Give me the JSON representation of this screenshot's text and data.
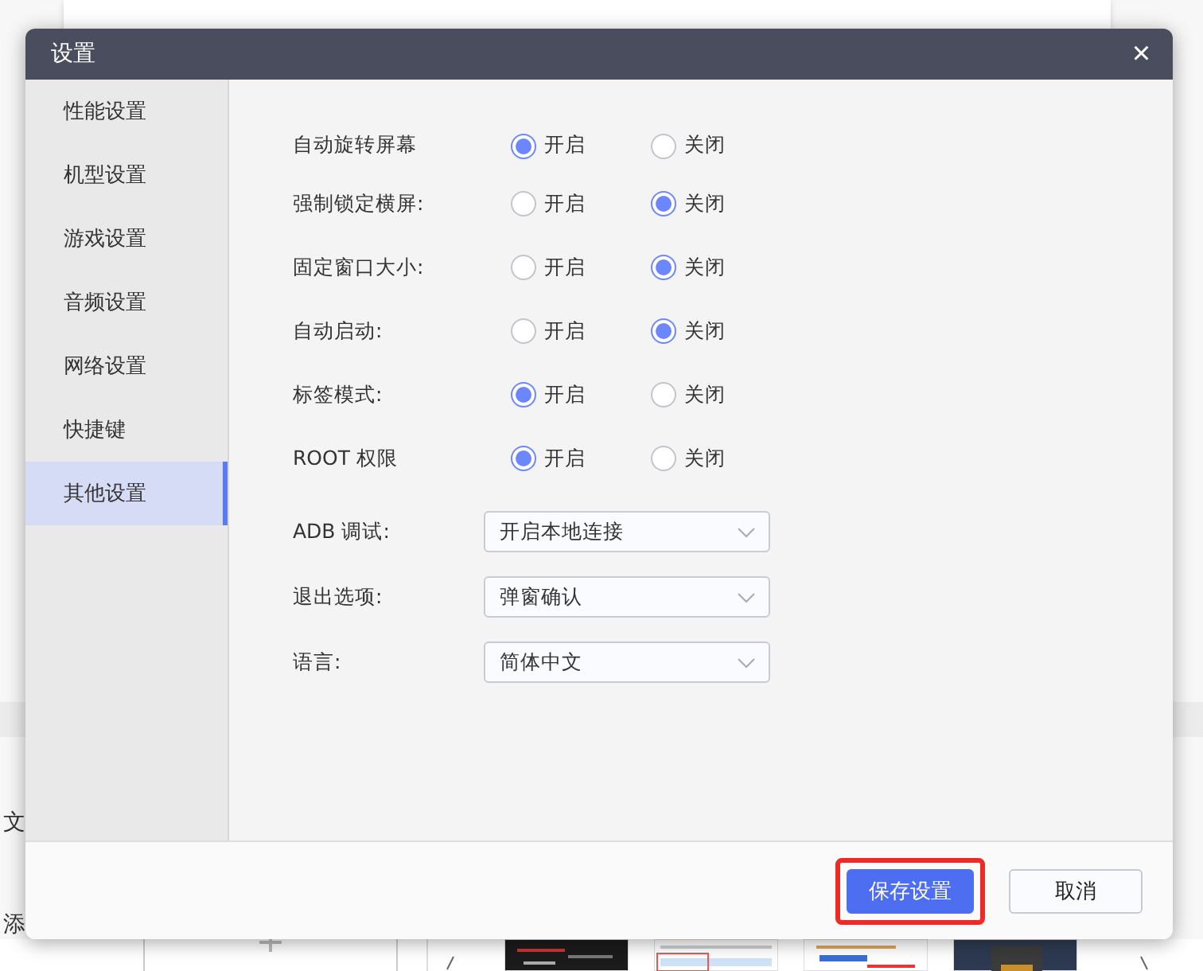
{
  "background": {
    "side_texts": [
      "文",
      "添"
    ]
  },
  "dialog": {
    "title": "设置",
    "close": "×",
    "sidebar": [
      {
        "label": "性能设置",
        "selected": false
      },
      {
        "label": "机型设置",
        "selected": false
      },
      {
        "label": "游戏设置",
        "selected": false
      },
      {
        "label": "音频设置",
        "selected": false
      },
      {
        "label": "网络设置",
        "selected": false
      },
      {
        "label": "快捷键",
        "selected": false
      },
      {
        "label": "其他设置",
        "selected": true
      }
    ],
    "toggles": [
      {
        "label": "自动旋转屏幕",
        "options": [
          {
            "label": "开启",
            "selected": true
          },
          {
            "label": "关闭",
            "selected": false
          }
        ]
      },
      {
        "label": "强制锁定横屏:",
        "options": [
          {
            "label": "开启",
            "selected": false
          },
          {
            "label": "关闭",
            "selected": true
          }
        ]
      },
      {
        "label": "固定窗口大小:",
        "options": [
          {
            "label": "开启",
            "selected": false
          },
          {
            "label": "关闭",
            "selected": true
          }
        ]
      },
      {
        "label": "自动启动:",
        "options": [
          {
            "label": "开启",
            "selected": false
          },
          {
            "label": "关闭",
            "selected": true
          }
        ]
      },
      {
        "label": "标签模式:",
        "options": [
          {
            "label": "开启",
            "selected": true
          },
          {
            "label": "关闭",
            "selected": false
          }
        ]
      },
      {
        "label": "ROOT 权限",
        "options": [
          {
            "label": "开启",
            "selected": true
          },
          {
            "label": "关闭",
            "selected": false
          }
        ]
      }
    ],
    "selects": [
      {
        "label": "ADB 调试:",
        "value": "开启本地连接"
      },
      {
        "label": "退出选项:",
        "value": "弹窗确认"
      },
      {
        "label": "语言:",
        "value": "简体中文"
      }
    ],
    "buttons": [
      {
        "label": "保存设置",
        "kind": "primary",
        "highlighted": true
      },
      {
        "label": "取消",
        "kind": "secondary",
        "highlighted": false
      }
    ]
  }
}
